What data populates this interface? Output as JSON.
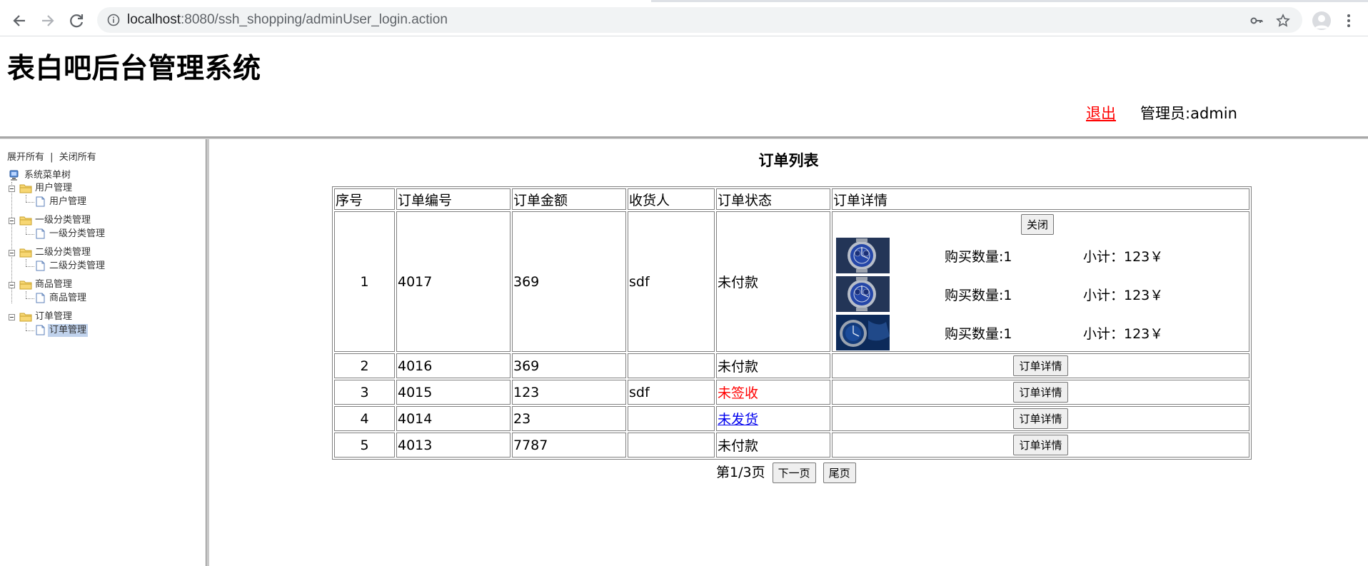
{
  "browser": {
    "url_host": "localhost",
    "url_rest": ":8080/ssh_shopping/adminUser_login.action"
  },
  "header": {
    "title": "表白吧后台管理系统",
    "logout_label": "退出",
    "admin_label": "管理员:admin",
    "logout_color": "#ff0000"
  },
  "tree": {
    "expand_all": "展开所有",
    "separator": "|",
    "collapse_all": "关闭所有",
    "root": "系统菜单树",
    "groups": [
      {
        "label": "用户管理",
        "child": "用户管理"
      },
      {
        "label": "一级分类管理",
        "child": "一级分类管理"
      },
      {
        "label": "二级分类管理",
        "child": "二级分类管理"
      },
      {
        "label": "商品管理",
        "child": "商品管理"
      },
      {
        "label": "订单管理",
        "child": "订单管理"
      }
    ],
    "selected": "订单管理"
  },
  "orders": {
    "title": "订单列表",
    "columns": [
      "序号",
      "订单编号",
      "订单金额",
      "收货人",
      "订单状态",
      "订单详情"
    ],
    "rows": [
      {
        "idx": "1",
        "code": "4017",
        "amount": "369",
        "receiver": "sdf",
        "status": "未付款",
        "status_style": "plain",
        "expanded": true
      },
      {
        "idx": "2",
        "code": "4016",
        "amount": "369",
        "receiver": "",
        "status": "未付款",
        "status_style": "plain",
        "expanded": false
      },
      {
        "idx": "3",
        "code": "4015",
        "amount": "123",
        "receiver": "sdf",
        "status": "未签收",
        "status_style": "red",
        "expanded": false
      },
      {
        "idx": "4",
        "code": "4014",
        "amount": "23",
        "receiver": "",
        "status": "未发货",
        "status_style": "link",
        "expanded": false
      },
      {
        "idx": "5",
        "code": "4013",
        "amount": "7787",
        "receiver": "",
        "status": "未付款",
        "status_style": "plain",
        "expanded": false
      }
    ],
    "detail": {
      "close_label": "关闭",
      "items": [
        {
          "qty": "购买数量:1",
          "subtotal": "小计：123￥",
          "thumb": "watch-silver-blue"
        },
        {
          "qty": "购买数量:1",
          "subtotal": "小计：123￥",
          "thumb": "watch-silver-blue"
        },
        {
          "qty": "购买数量:1",
          "subtotal": "小计：123￥",
          "thumb": "watch-dark-blue"
        }
      ]
    },
    "detail_button_label": "订单详情",
    "pager": {
      "text": "第1/3页",
      "next_label": "下一页",
      "last_label": "尾页"
    }
  },
  "colors": {
    "accent_link": "#0000ee",
    "status_red": "#ff0000",
    "selected_bg": "#c0d2ec"
  }
}
